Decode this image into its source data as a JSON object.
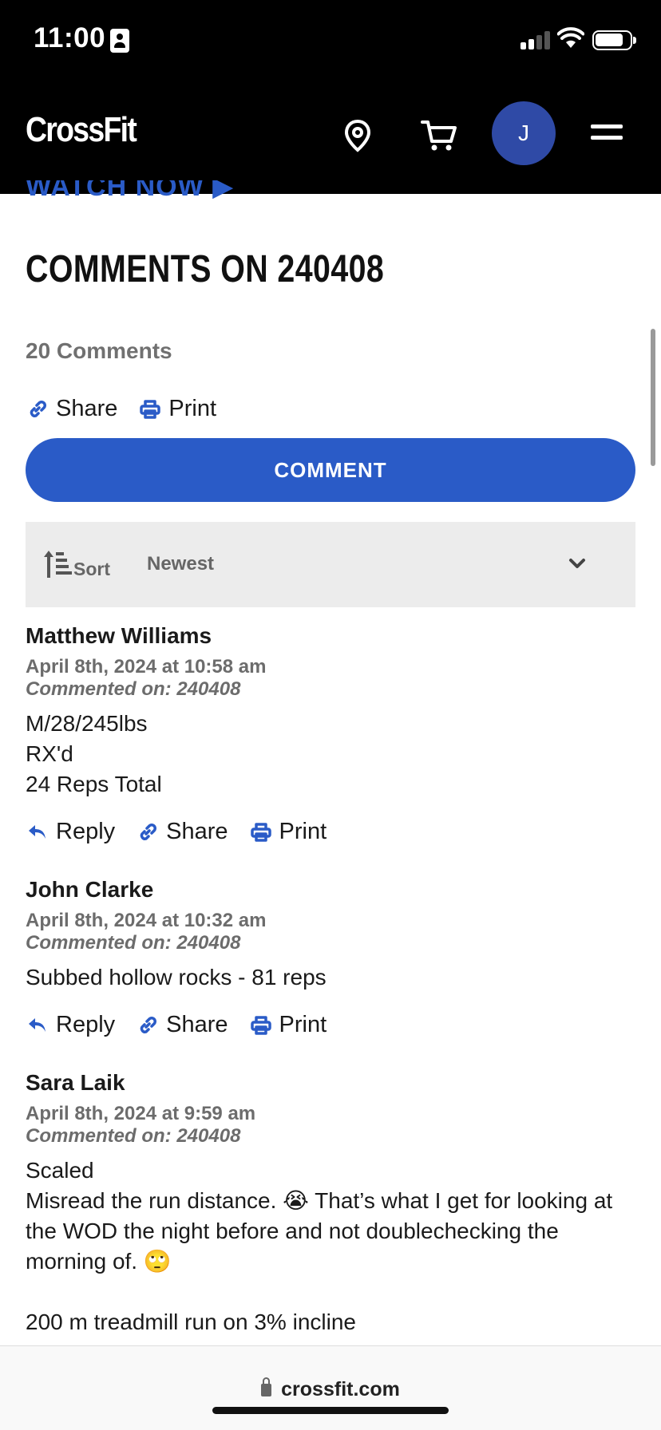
{
  "status_bar": {
    "time": "11:00"
  },
  "header": {
    "logo": "CrossFit",
    "avatar_initial": "J",
    "icons": [
      "location-pin-icon",
      "cart-icon",
      "menu-icon"
    ]
  },
  "page": {
    "peek_link": "WATCH NOW ▶",
    "title": "COMMENTS ON 240408",
    "comments_count": "20 Comments",
    "share_label": "Share",
    "print_label": "Print",
    "comment_button": "COMMENT",
    "sort_label": "Sort",
    "sort_value": "Newest"
  },
  "comments": [
    {
      "author": "Matthew Williams",
      "date": "April 8th, 2024 at 10:58 am",
      "commented_on": "Commented on: 240408",
      "lines": [
        "M/28/245lbs",
        "RX'd",
        "24 Reps Total"
      ],
      "reply": "Reply",
      "share": "Share",
      "print": "Print"
    },
    {
      "author": "John Clarke",
      "date": "April 8th, 2024 at 10:32 am",
      "commented_on": "Commented on: 240408",
      "lines": [
        "Subbed hollow rocks - 81 reps"
      ],
      "reply": "Reply",
      "share": "Share",
      "print": "Print"
    },
    {
      "author": "Sara Laik",
      "date": "April 8th, 2024 at 9:59 am",
      "commented_on": "Commented on: 240408",
      "lines": [
        "Scaled",
        "Misread the run distance. 😭 That’s what I get for looking at the WOD the night before and not doublechecking the morning of. 🙄",
        "",
        "200 m treadmill run on 3% incline"
      ]
    }
  ],
  "browser": {
    "url": "crossfit.com"
  },
  "colors": {
    "brand_blue": "#2a5bc7",
    "avatar_blue": "#2f4aa6",
    "header_black": "#000000"
  }
}
